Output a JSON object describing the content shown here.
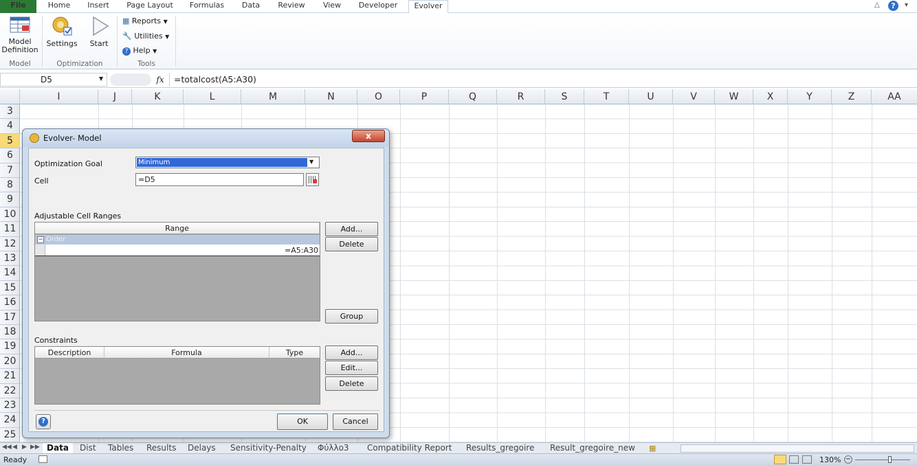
{
  "ribbon_tabs": [
    "File",
    "Home",
    "Insert",
    "Page Layout",
    "Formulas",
    "Data",
    "Review",
    "View",
    "Developer",
    "Evolver"
  ],
  "ribbon": {
    "model_def_line1": "Model",
    "model_def_line2": "Definition",
    "settings": "Settings",
    "start": "Start",
    "reports": "Reports",
    "utilities": "Utilities",
    "help": "Help",
    "groups": [
      "Model",
      "Optimization",
      "Tools"
    ]
  },
  "formula_bar": {
    "name_box": "D5",
    "fx": "fx",
    "formula": "=totalcost(A5:A30)"
  },
  "columns": [
    "I",
    "J",
    "K",
    "L",
    "M",
    "N",
    "O",
    "P",
    "Q",
    "R",
    "S",
    "T",
    "U",
    "V",
    "W",
    "X",
    "Y",
    "Z",
    "AA"
  ],
  "rows": [
    "3",
    "4",
    "5",
    "6",
    "7",
    "8",
    "9",
    "10",
    "11",
    "12",
    "13",
    "14",
    "15",
    "16",
    "17",
    "18",
    "19",
    "20",
    "21",
    "22",
    "23",
    "24",
    "25"
  ],
  "selected_row": "5",
  "dialog": {
    "title": "Evolver- Model",
    "close": "x",
    "goal_label": "Optimization Goal",
    "goal_value": "Minimum",
    "cell_label": "Cell",
    "cell_value": "=D5",
    "adjustable_label": "Adjustable Cell Ranges",
    "range_header": "Range",
    "group_name": "Order",
    "range_value": "=A5:A30",
    "add_label": "Add...",
    "delete_label": "Delete",
    "group_label": "Group",
    "constraints_label": "Constraints",
    "constraint_headers": [
      "Description",
      "Formula",
      "Type"
    ],
    "c_add_label": "Add...",
    "c_edit_label": "Edit...",
    "c_delete_label": "Delete",
    "ok_label": "OK",
    "cancel_label": "Cancel"
  },
  "sheet_tabs": [
    "Data",
    "Dist",
    "Tables",
    "Results",
    "Delays",
    "Sensitivity-Penalty",
    "Φύλλο3",
    "Compatibility Report",
    "Results_gregoire",
    "Result_gregoire_new"
  ],
  "status": {
    "ready": "Ready",
    "zoom": "130%"
  },
  "colors": {
    "file_tab": "#2a7a34",
    "selection": "#3268d6",
    "row_highlight": "#f9d978"
  }
}
